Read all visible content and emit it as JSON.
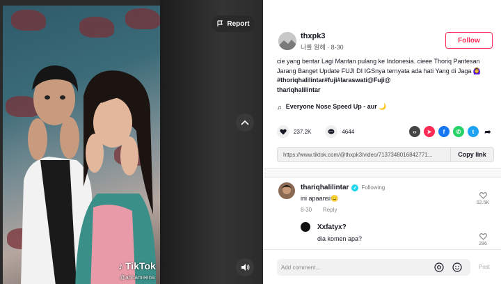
{
  "video": {
    "report_label": "Report",
    "watermark": "TikTok",
    "watermark_handle": "@ahhameena"
  },
  "author": {
    "username": "thxpk3",
    "subtitle": "나를 원해 · 8-30",
    "follow_label": "Follow"
  },
  "caption": {
    "text": "cie yang bentar Lagi Mantan pulang ke Indonesia. cieee Thoriq Pantesan Jarang Banget Update FUJI DI IGSnya ternyata ada hati Yang di Jaga 🙆‍♀️ ",
    "hashtags": "#thoriqhalilintar#fuji#laraswati@Fuji@",
    "mention": "thariqhalilintar"
  },
  "music": {
    "title": "Everyone Nose Speed Up - aur 🌙"
  },
  "stats": {
    "likes": "237.2K",
    "comments": "4644"
  },
  "share": {
    "icons": [
      "embed-icon",
      "send-icon",
      "facebook-icon",
      "whatsapp-icon",
      "twitter-icon",
      "share-arrow-icon"
    ]
  },
  "link": {
    "url": "https://www.tiktok.com/@thxpk3/video/7137348016842771...",
    "copy_label": "Copy link"
  },
  "comments": [
    {
      "username": "thariqhalilintar",
      "badge": "Following",
      "text": "ini apaansi😑",
      "date": "8-30",
      "reply_label": "Reply",
      "likes": "52.5K"
    },
    {
      "username": "Xxfatyx?",
      "text": "dia komen apa?",
      "likes": "286"
    }
  ],
  "composer": {
    "placeholder": "Add comment...",
    "post_label": "Post"
  },
  "colors": {
    "accent": "#fe2c55",
    "verified": "#20d5ec",
    "facebook": "#1877f2",
    "whatsapp": "#25d366",
    "twitter": "#1da1f2"
  }
}
